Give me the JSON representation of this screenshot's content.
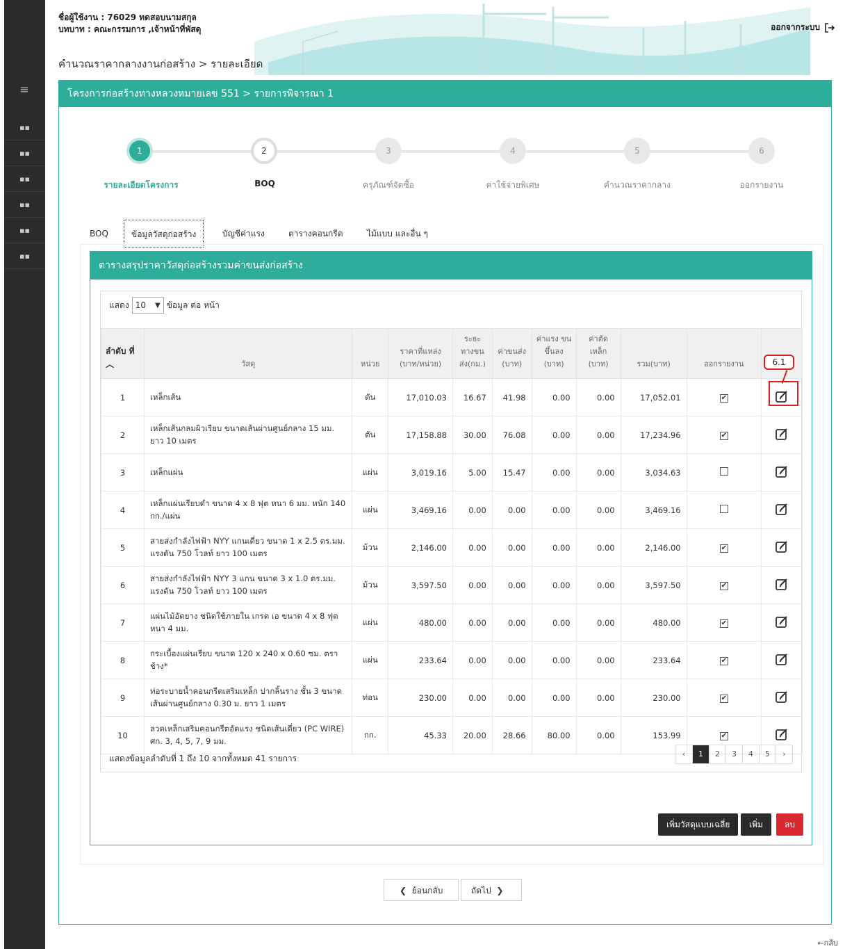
{
  "header": {
    "user_line": "ชื่อผู้ใช้งาน : 76029 ทดสอบนามสกุล",
    "role_line": "บทบาท : คณะกรรมการ ,เจ้าหน้าที่พัสดุ",
    "breadcrumb": "คำนวณราคากลางงานก่อสร้าง > รายละเอียด",
    "logout_label": "ออกจากระบบ"
  },
  "card": {
    "title": "โครงการก่อสร้างทางหลวงหมายเลข 551 > รายการพิจารณา 1"
  },
  "steps": [
    {
      "num": "1",
      "label": "รายละเอียดโครงการ"
    },
    {
      "num": "2",
      "label": "BOQ"
    },
    {
      "num": "3",
      "label": "ครุภัณฑ์จัดซื้อ"
    },
    {
      "num": "4",
      "label": "ค่าใช้จ่ายพิเศษ"
    },
    {
      "num": "5",
      "label": "คำนวณราคากลาง"
    },
    {
      "num": "6",
      "label": "ออกรายงาน"
    }
  ],
  "tabs": [
    "BOQ",
    "ข้อมูลวัสดุก่อสร้าง",
    "บัญชีค่าแรง",
    "ตารางคอนกรีต",
    "ไม้แบบ และอื่น ๆ"
  ],
  "panel": {
    "title": "ตารางสรุปราคาวัสดุก่อสร้างรวมค่าขนส่งก่อสร้าง",
    "show_prefix": "แสดง",
    "page_size": "10",
    "show_suffix": "ข้อมูล ต่อ หน้า",
    "footer_info": "แสดงข้อมูลลำดับที่ 1 ถึง 10 จากทั้งหมด 41 รายการ"
  },
  "table": {
    "headers": {
      "no": "ลำดับ ที่",
      "material": "วัสดุ",
      "unit": "หน่วย",
      "source_price": "ราคาที่แหล่ง (บาท/หน่วย)",
      "distance": "ระยะ ทางขน ส่ง(กม.)",
      "transport": "ค่าขนส่ง (บาท)",
      "labor": "ค่าแรง ขนขึ้นลง (บาท)",
      "cut": "ค่าตัด เหล็ก (บาท)",
      "total": "รวม(บาท)",
      "report": "ออกรายงาน"
    },
    "rows": [
      {
        "no": "1",
        "material": "เหล็กเส้น",
        "unit": "ตัน",
        "source_price": "17,010.03",
        "distance": "16.67",
        "transport": "41.98",
        "labor": "0.00",
        "cut": "0.00",
        "total": "17,052.01",
        "report": "✔"
      },
      {
        "no": "2",
        "material": "เหล็กเส้นกลมผิวเรียบ ขนาดเส้นผ่านศูนย์กลาง 15 มม. ยาว 10 เมตร",
        "unit": "ตัน",
        "source_price": "17,158.88",
        "distance": "30.00",
        "transport": "76.08",
        "labor": "0.00",
        "cut": "0.00",
        "total": "17,234.96",
        "report": "✔"
      },
      {
        "no": "3",
        "material": "เหล็กแผ่น",
        "unit": "แผ่น",
        "source_price": "3,019.16",
        "distance": "5.00",
        "transport": "15.47",
        "labor": "0.00",
        "cut": "0.00",
        "total": "3,034.63",
        "report": ""
      },
      {
        "no": "4",
        "material": "เหล็กแผ่นเรียบดำ ขนาด 4 x 8 ฟุต หนา 6 มม. หนัก 140 กก./แผ่น",
        "unit": "แผ่น",
        "source_price": "3,469.16",
        "distance": "0.00",
        "transport": "0.00",
        "labor": "0.00",
        "cut": "0.00",
        "total": "3,469.16",
        "report": ""
      },
      {
        "no": "5",
        "material": "สายส่งกำลังไฟฟ้า NYY แกนเดี่ยว ขนาด 1 x 2.5 ตร.มม. แรงดัน 750 โวลท์ ยาว 100 เมตร",
        "unit": "ม้วน",
        "source_price": "2,146.00",
        "distance": "0.00",
        "transport": "0.00",
        "labor": "0.00",
        "cut": "0.00",
        "total": "2,146.00",
        "report": "✔"
      },
      {
        "no": "6",
        "material": "สายส่งกำลังไฟฟ้า NYY 3 แกน ขนาด 3 x 1.0 ตร.มม. แรงดัน 750 โวลท์ ยาว 100 เมตร",
        "unit": "ม้วน",
        "source_price": "3,597.50",
        "distance": "0.00",
        "transport": "0.00",
        "labor": "0.00",
        "cut": "0.00",
        "total": "3,597.50",
        "report": "✔"
      },
      {
        "no": "7",
        "material": "แผ่นไม้อัดยาง ชนิดใช้ภายใน เกรด เอ ขนาด 4 x 8 ฟุต หนา 4 มม.",
        "unit": "แผ่น",
        "source_price": "480.00",
        "distance": "0.00",
        "transport": "0.00",
        "labor": "0.00",
        "cut": "0.00",
        "total": "480.00",
        "report": "✔"
      },
      {
        "no": "8",
        "material": "กระเบื้องแผ่นเรียบ ขนาด 120 x 240 x 0.60 ซม. ตราช้าง*",
        "unit": "แผ่น",
        "source_price": "233.64",
        "distance": "0.00",
        "transport": "0.00",
        "labor": "0.00",
        "cut": "0.00",
        "total": "233.64",
        "report": "✔"
      },
      {
        "no": "9",
        "material": "ท่อระบายน้ำคอนกรีตเสริมเหล็ก ปากลิ้นราง ชั้น 3 ขนาดเส้นผ่านศูนย์กลาง 0.30 ม. ยาว 1 เมตร",
        "unit": "ท่อน",
        "source_price": "230.00",
        "distance": "0.00",
        "transport": "0.00",
        "labor": "0.00",
        "cut": "0.00",
        "total": "230.00",
        "report": "✔"
      },
      {
        "no": "10",
        "material": "ลวดเหล็กเสริมคอนกรีตอัดแรง ชนิดเส้นเดี่ยว (PC WIRE) ศก. 3, 4, 5, 7, 9 มม.",
        "unit": "กก.",
        "source_price": "45.33",
        "distance": "20.00",
        "transport": "28.66",
        "labor": "80.00",
        "cut": "0.00",
        "total": "153.99",
        "report": "✔"
      }
    ]
  },
  "pager": {
    "prev": "‹",
    "pages": [
      "1",
      "2",
      "3",
      "4",
      "5"
    ],
    "next": "›"
  },
  "actions": {
    "add_average": "เพิ่มวัสดุแบบเฉลี่ย",
    "add": "เพิ่ม",
    "delete": "ลบ"
  },
  "nav": {
    "back": "ย้อนกลับ",
    "next": "ถัดไป"
  },
  "callout_label": "6.1",
  "bottom_back": "←กลับ",
  "colors": {
    "accent": "#2eae9a",
    "dark": "#2b2b2b",
    "danger": "#d9282f"
  }
}
